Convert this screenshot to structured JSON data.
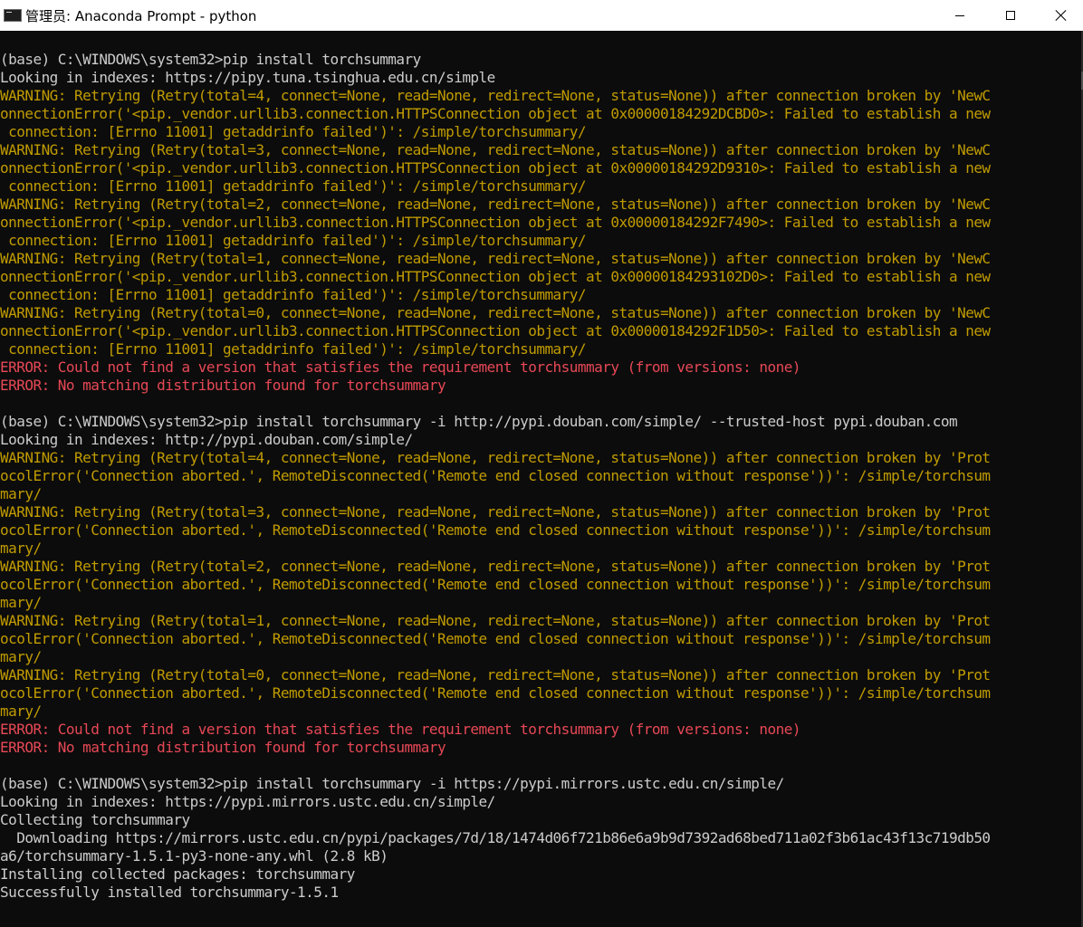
{
  "window": {
    "title": "管理员: Anaconda Prompt - python"
  },
  "console": {
    "lines": [
      {
        "t": "(base) C:\\WINDOWS\\system32>pip install torchsummary",
        "c": "n"
      },
      {
        "t": "Looking in indexes: https://pipy.tuna.tsinghua.edu.cn/simple",
        "c": "n"
      },
      {
        "t": "WARNING: Retrying (Retry(total=4, connect=None, read=None, redirect=None, status=None)) after connection broken by 'NewC",
        "c": "w"
      },
      {
        "t": "onnectionError('<pip._vendor.urllib3.connection.HTTPSConnection object at 0x00000184292DCBD0>: Failed to establish a new",
        "c": "w"
      },
      {
        "t": " connection: [Errno 11001] getaddrinfo failed')': /simple/torchsummary/",
        "c": "w"
      },
      {
        "t": "WARNING: Retrying (Retry(total=3, connect=None, read=None, redirect=None, status=None)) after connection broken by 'NewC",
        "c": "w"
      },
      {
        "t": "onnectionError('<pip._vendor.urllib3.connection.HTTPSConnection object at 0x00000184292D9310>: Failed to establish a new",
        "c": "w"
      },
      {
        "t": " connection: [Errno 11001] getaddrinfo failed')': /simple/torchsummary/",
        "c": "w"
      },
      {
        "t": "WARNING: Retrying (Retry(total=2, connect=None, read=None, redirect=None, status=None)) after connection broken by 'NewC",
        "c": "w"
      },
      {
        "t": "onnectionError('<pip._vendor.urllib3.connection.HTTPSConnection object at 0x00000184292F7490>: Failed to establish a new",
        "c": "w"
      },
      {
        "t": " connection: [Errno 11001] getaddrinfo failed')': /simple/torchsummary/",
        "c": "w"
      },
      {
        "t": "WARNING: Retrying (Retry(total=1, connect=None, read=None, redirect=None, status=None)) after connection broken by 'NewC",
        "c": "w"
      },
      {
        "t": "onnectionError('<pip._vendor.urllib3.connection.HTTPSConnection object at 0x00000184293102D0>: Failed to establish a new",
        "c": "w"
      },
      {
        "t": " connection: [Errno 11001] getaddrinfo failed')': /simple/torchsummary/",
        "c": "w"
      },
      {
        "t": "WARNING: Retrying (Retry(total=0, connect=None, read=None, redirect=None, status=None)) after connection broken by 'NewC",
        "c": "w"
      },
      {
        "t": "onnectionError('<pip._vendor.urllib3.connection.HTTPSConnection object at 0x00000184292F1D50>: Failed to establish a new",
        "c": "w"
      },
      {
        "t": " connection: [Errno 11001] getaddrinfo failed')': /simple/torchsummary/",
        "c": "w"
      },
      {
        "t": "ERROR: Could not find a version that satisfies the requirement torchsummary (from versions: none)",
        "c": "e"
      },
      {
        "t": "ERROR: No matching distribution found for torchsummary",
        "c": "e"
      },
      {
        "t": "",
        "c": "b"
      },
      {
        "t": "(base) C:\\WINDOWS\\system32>pip install torchsummary -i http://pypi.douban.com/simple/ --trusted-host pypi.douban.com",
        "c": "n"
      },
      {
        "t": "Looking in indexes: http://pypi.douban.com/simple/",
        "c": "n"
      },
      {
        "t": "WARNING: Retrying (Retry(total=4, connect=None, read=None, redirect=None, status=None)) after connection broken by 'Prot",
        "c": "w"
      },
      {
        "t": "ocolError('Connection aborted.', RemoteDisconnected('Remote end closed connection without response'))': /simple/torchsum",
        "c": "w"
      },
      {
        "t": "mary/",
        "c": "w"
      },
      {
        "t": "WARNING: Retrying (Retry(total=3, connect=None, read=None, redirect=None, status=None)) after connection broken by 'Prot",
        "c": "w"
      },
      {
        "t": "ocolError('Connection aborted.', RemoteDisconnected('Remote end closed connection without response'))': /simple/torchsum",
        "c": "w"
      },
      {
        "t": "mary/",
        "c": "w"
      },
      {
        "t": "WARNING: Retrying (Retry(total=2, connect=None, read=None, redirect=None, status=None)) after connection broken by 'Prot",
        "c": "w"
      },
      {
        "t": "ocolError('Connection aborted.', RemoteDisconnected('Remote end closed connection without response'))': /simple/torchsum",
        "c": "w"
      },
      {
        "t": "mary/",
        "c": "w"
      },
      {
        "t": "WARNING: Retrying (Retry(total=1, connect=None, read=None, redirect=None, status=None)) after connection broken by 'Prot",
        "c": "w"
      },
      {
        "t": "ocolError('Connection aborted.', RemoteDisconnected('Remote end closed connection without response'))': /simple/torchsum",
        "c": "w"
      },
      {
        "t": "mary/",
        "c": "w"
      },
      {
        "t": "WARNING: Retrying (Retry(total=0, connect=None, read=None, redirect=None, status=None)) after connection broken by 'Prot",
        "c": "w"
      },
      {
        "t": "ocolError('Connection aborted.', RemoteDisconnected('Remote end closed connection without response'))': /simple/torchsum",
        "c": "w"
      },
      {
        "t": "mary/",
        "c": "w"
      },
      {
        "t": "ERROR: Could not find a version that satisfies the requirement torchsummary (from versions: none)",
        "c": "e"
      },
      {
        "t": "ERROR: No matching distribution found for torchsummary",
        "c": "e"
      },
      {
        "t": "",
        "c": "b"
      },
      {
        "t": "(base) C:\\WINDOWS\\system32>pip install torchsummary -i https://pypi.mirrors.ustc.edu.cn/simple/",
        "c": "n"
      },
      {
        "t": "Looking in indexes: https://pypi.mirrors.ustc.edu.cn/simple/",
        "c": "n"
      },
      {
        "t": "Collecting torchsummary",
        "c": "n"
      },
      {
        "t": "  Downloading https://mirrors.ustc.edu.cn/pypi/packages/7d/18/1474d06f721b86e6a9b9d7392ad68bed711a02f3b61ac43f13c719db50",
        "c": "n"
      },
      {
        "t": "a6/torchsummary-1.5.1-py3-none-any.whl (2.8 kB)",
        "c": "n"
      },
      {
        "t": "Installing collected packages: torchsummary",
        "c": "n"
      },
      {
        "t": "Successfully installed torchsummary-1.5.1",
        "c": "n"
      }
    ]
  },
  "colors": {
    "background": "#0c0c0c",
    "normal_text": "#cccccc",
    "warning_text": "#c19c00",
    "error_text": "#e74856"
  }
}
